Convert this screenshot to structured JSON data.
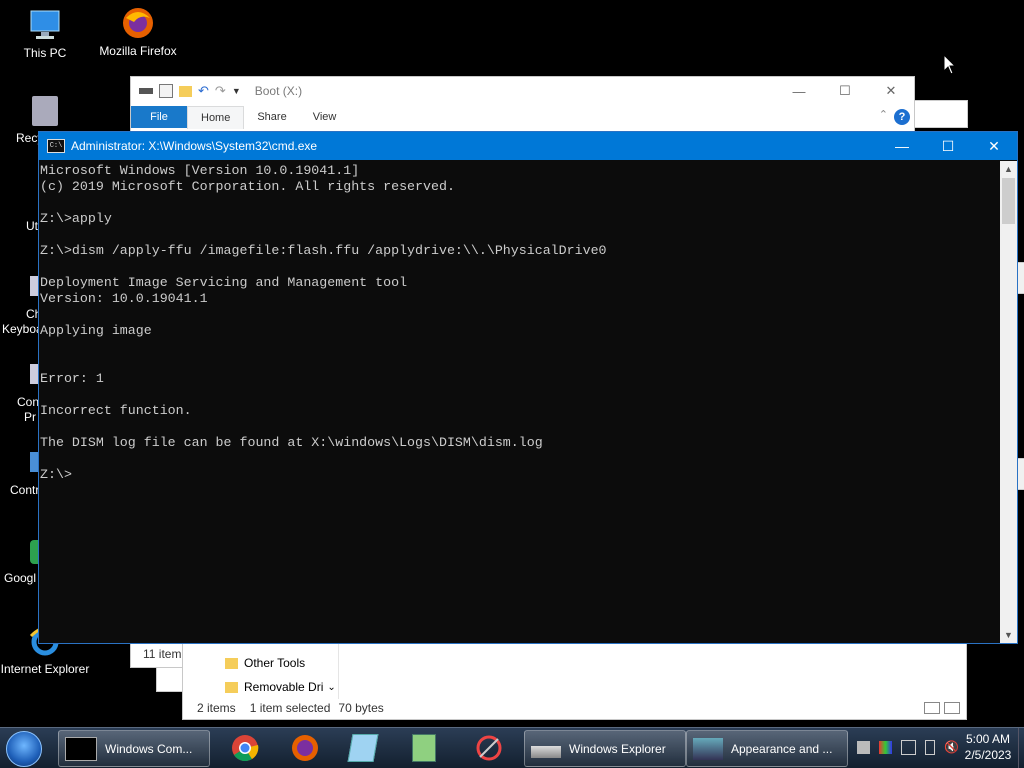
{
  "desktop": {
    "icons": [
      {
        "label": "This PC"
      },
      {
        "label": "Mozilla Firefox"
      },
      {
        "label": "Internet Explorer"
      }
    ],
    "partial_labels": [
      "Recy",
      "Ut",
      "Ch",
      "Keyboa",
      "Con",
      "Pr",
      "Contr",
      "Googl"
    ]
  },
  "explorer": {
    "title": "Boot (X:)",
    "tabs": [
      "File",
      "Home",
      "Share",
      "View"
    ],
    "status_items": "11 item",
    "second": {
      "nav_items": [
        "Other Tools",
        "Removable Dri"
      ],
      "status": {
        "count": "2 items",
        "selected": "1 item selected",
        "size": "70 bytes"
      }
    }
  },
  "cmd": {
    "title": "Administrator: X:\\Windows\\System32\\cmd.exe",
    "console_lines": [
      "Microsoft Windows [Version 10.0.19041.1]",
      "(c) 2019 Microsoft Corporation. All rights reserved.",
      "",
      "Z:\\>apply",
      "",
      "Z:\\>dism /apply-ffu /imagefile:flash.ffu /applydrive:\\\\.\\PhysicalDrive0",
      "",
      "Deployment Image Servicing and Management tool",
      "Version: 10.0.19041.1",
      "",
      "Applying image",
      "",
      "",
      "Error: 1",
      "",
      "Incorrect function.",
      "",
      "The DISM log file can be found at X:\\windows\\Logs\\DISM\\dism.log",
      "",
      "Z:\\>"
    ]
  },
  "taskbar": {
    "buttons": [
      {
        "label": "Windows Com..."
      },
      {
        "label": "Windows Explorer"
      },
      {
        "label": "Appearance and ..."
      }
    ],
    "clock": {
      "time": "5:00 AM",
      "date": "2/5/2023"
    }
  },
  "colors": {
    "cmd_title": "#0078d7",
    "console_bg": "#0c0c0c",
    "console_fg": "#cccccc",
    "ribbon_file": "#1979ca"
  }
}
